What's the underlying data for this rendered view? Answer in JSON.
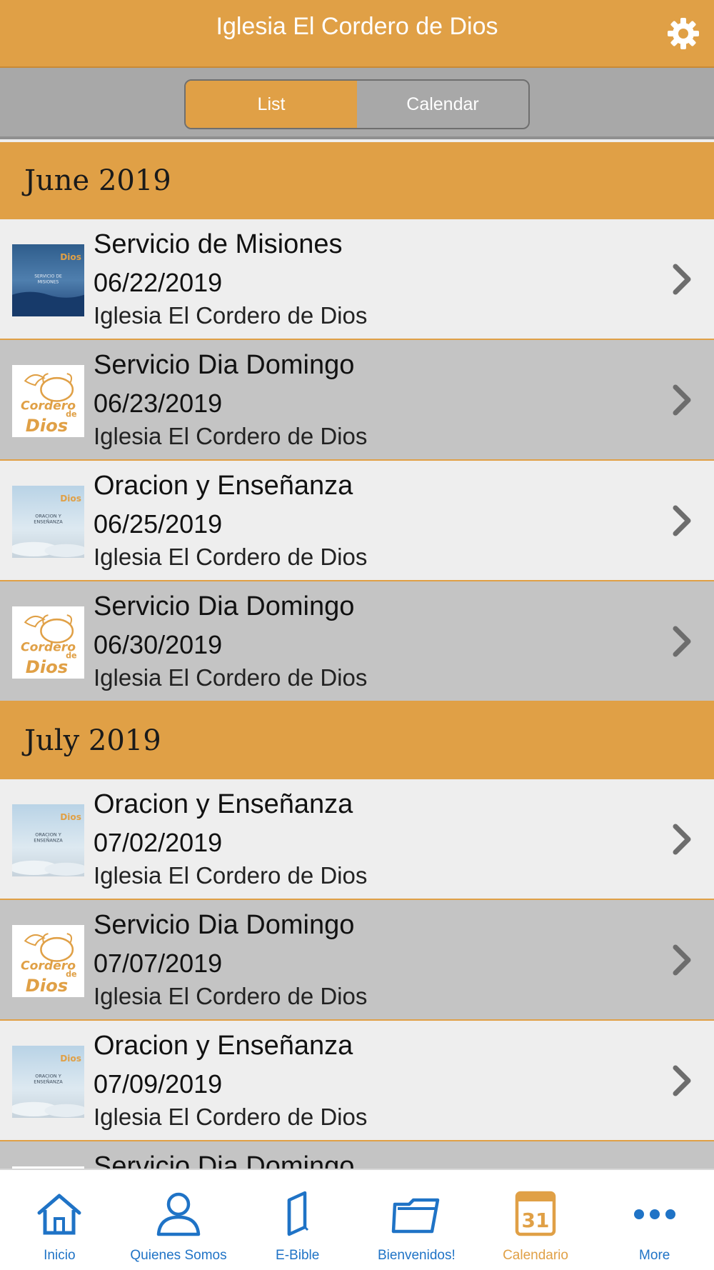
{
  "header": {
    "title": "Iglesia El Cordero de Dios"
  },
  "segments": {
    "list_label": "List",
    "calendar_label": "Calendar",
    "selected": "List"
  },
  "sections": [
    {
      "month": "June 2019",
      "events": [
        {
          "title": "Servicio de Misiones",
          "date": "06/22/2019",
          "place": "Iglesia El Cordero de Dios",
          "thumb": "misiones",
          "thumb_text": "SERVICIO DE MISIONES"
        },
        {
          "title": "Servicio Dia Domingo",
          "date": "06/23/2019",
          "place": "Iglesia El Cordero de Dios",
          "thumb": "logo"
        },
        {
          "title": "Oracion y Enseñanza",
          "date": "06/25/2019",
          "place": "Iglesia El Cordero de Dios",
          "thumb": "oracion",
          "thumb_text": "ORACION Y ENSEÑANZA"
        },
        {
          "title": "Servicio Dia Domingo",
          "date": "06/30/2019",
          "place": "Iglesia El Cordero de Dios",
          "thumb": "logo"
        }
      ]
    },
    {
      "month": "July 2019",
      "events": [
        {
          "title": "Oracion y Enseñanza",
          "date": "07/02/2019",
          "place": "Iglesia El Cordero de Dios",
          "thumb": "oracion",
          "thumb_text": "ORACION Y ENSEÑANZA"
        },
        {
          "title": "Servicio Dia Domingo",
          "date": "07/07/2019",
          "place": "Iglesia El Cordero de Dios",
          "thumb": "logo"
        },
        {
          "title": "Oracion y Enseñanza",
          "date": "07/09/2019",
          "place": "Iglesia El Cordero de Dios",
          "thumb": "oracion",
          "thumb_text": "ORACION Y ENSEÑANZA"
        },
        {
          "title": "Servicio Dia Domingo",
          "date": "",
          "place": "",
          "thumb": "logo"
        }
      ]
    }
  ],
  "tabbar": {
    "items": [
      {
        "label": "Inicio",
        "icon": "home-icon"
      },
      {
        "label": "Quienes Somos",
        "icon": "person-icon"
      },
      {
        "label": "E-Bible",
        "icon": "book-icon"
      },
      {
        "label": "Bienvenidos!",
        "icon": "folder-icon"
      },
      {
        "label": "Calendario",
        "icon": "calendar-icon",
        "icon_text": "31",
        "active": true
      },
      {
        "label": "More",
        "icon": "more-icon"
      }
    ]
  },
  "colors": {
    "accent": "#e0a046",
    "tab_blue": "#1f73c6",
    "row_alt": "#c4c4c4",
    "row_plain": "#eeeeee"
  }
}
